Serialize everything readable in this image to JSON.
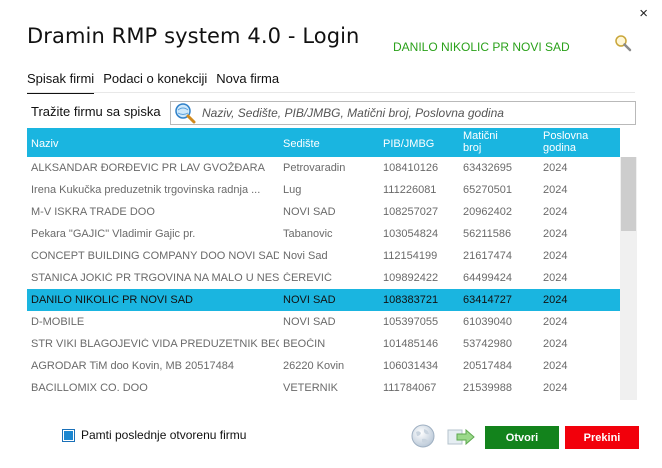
{
  "window": {
    "title": "Dramin RMP system 4.0 - Login",
    "close_glyph": "×",
    "current_company": "DANILO NIKOLIC PR NOVI SAD"
  },
  "tabs": [
    {
      "label": "Spisak firmi",
      "active": true
    },
    {
      "label": "Podaci o konekciji",
      "active": false
    },
    {
      "label": "Nova firma",
      "active": false
    }
  ],
  "search": {
    "label": "Tražite firmu sa spiska",
    "placeholder": "Naziv, Sedište, PIB/JMBG, Matični broj, Poslovna godina",
    "value": ""
  },
  "table": {
    "columns": {
      "naziv": "Naziv",
      "sediste": "Sedište",
      "pib": "PIB/JMBG",
      "mb": "Matični\nbroj",
      "godina": "Poslovna\ngodina"
    },
    "rows": [
      {
        "naziv": "ALKSANDAR ĐORĐEVIC PR LAV GVOŽĐARA",
        "sediste": "Petrovaradin",
        "pib": "108410126",
        "mb": "63432695",
        "godina": "2024"
      },
      {
        "naziv": "Irena Kukučka preduzetnik trgovinska radnja ...",
        "sediste": "Lug",
        "pib": "111226081",
        "mb": "65270501",
        "godina": "2024"
      },
      {
        "naziv": "M-V ISKRA TRADE DOO",
        "sediste": "NOVI SAD",
        "pib": "108257027",
        "mb": "20962402",
        "godina": "2024"
      },
      {
        "naziv": "Pekara \"GAJIC\" Vladimir Gajic pr.",
        "sediste": "Tabanovic",
        "pib": "103054824",
        "mb": "56211586",
        "godina": "2024"
      },
      {
        "naziv": "CONCEPT BUILDING COMPANY DOO NOVI SAD",
        "sediste": "Novi Sad",
        "pib": "112154199",
        "mb": "21617474",
        "godina": "2024"
      },
      {
        "naziv": "STANICA JOKIĆ PR TRGOVINA NA MALO U NES...",
        "sediste": "ČEREVIĆ",
        "pib": "109892422",
        "mb": "64499424",
        "godina": "2024"
      },
      {
        "naziv": "DANILO NIKOLIC PR NOVI SAD",
        "sediste": "NOVI SAD",
        "pib": "108383721",
        "mb": "63414727",
        "godina": "2024",
        "selected": true
      },
      {
        "naziv": "D-MOBILE",
        "sediste": "NOVI SAD",
        "pib": "105397055",
        "mb": "61039040",
        "godina": "2024"
      },
      {
        "naziv": "STR VIKI BLAGOJEVIĆ VIDA PREDUZETNIK BEO...",
        "sediste": "BEOČIN",
        "pib": "101485146",
        "mb": "53742980",
        "godina": "2024"
      },
      {
        "naziv": "AGRODAR TiM doo Kovin, MB 20517484",
        "sediste": "26220 Kovin",
        "pib": "106031434",
        "mb": "20517484",
        "godina": "2024"
      },
      {
        "naziv": "BACILLOMIX CO. DOO",
        "sediste": "VETERNIK",
        "pib": "111784067",
        "mb": "21539988",
        "godina": "2024"
      }
    ]
  },
  "remember": {
    "label": "Pamti poslednje otvorenu firmu",
    "checked": true
  },
  "buttons": {
    "open": "Otvori",
    "cancel": "Prekini"
  },
  "icons": {
    "top_search": "magnifier-icon",
    "search_field": "search-globe-icon",
    "globe": "globe-icon",
    "transfer": "arrow-right-icon"
  },
  "colors": {
    "accent": "#1ab5e0",
    "company_name": "#2aa11a",
    "open_button": "#13831c",
    "cancel_button": "#f2000b"
  }
}
